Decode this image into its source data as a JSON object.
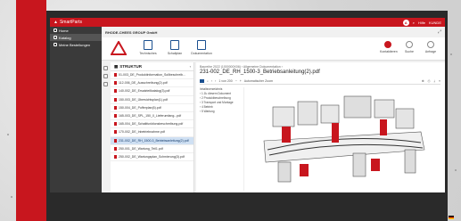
{
  "app": {
    "brand": "SmartParts",
    "company": "RHODE-CHEES GROUP GmbH",
    "user": "Hilfe",
    "account": "KUNDE",
    "avatar_letter": "A",
    "brand_color": "#c8161e",
    "selection_color": "#cfe0f3"
  },
  "sidebar": {
    "items": [
      {
        "label": "Home",
        "icon": "home-icon",
        "active": false
      },
      {
        "label": "Katalog",
        "icon": "book-icon",
        "active": true
      },
      {
        "label": "Meine Bestellungen",
        "icon": "list-icon",
        "active": false
      }
    ]
  },
  "toolbar": {
    "tools": [
      {
        "label": "Technisches",
        "icon": "tech-doc-icon"
      },
      {
        "label": "Schaltplan",
        "icon": "circuit-icon"
      },
      {
        "label": "Dokumentation",
        "icon": "document-icon"
      }
    ],
    "right_tools": [
      {
        "label": "Kontaktieren",
        "icon": "contact-icon"
      },
      {
        "label": "Suche",
        "icon": "search-icon"
      },
      {
        "label": "Anfrage",
        "icon": "cart-icon"
      }
    ]
  },
  "structure": {
    "title": "STRUKTUR",
    "files": [
      "01-003_DE_Produktinformation_Sollbeschreib...",
      "112-006_DE_Ausschreibung(2).pdf",
      "140-002_DE_Ersatzteilkatalog(3).pdf",
      "150-003_DE_Übersichtsplan(1).pdf",
      "150-004_DE_Pufferplan(6).pdf",
      "165-003_DE_SPL_150_0_Lieferumfang...pdf",
      "165-004_DE_Schaltfunktionsbeschreibung.pdf",
      "170-002_DE_Inbetriebnahme.pdf",
      "231-002_DE_RH_1500-3_Betriebsanleitung(2).pdf",
      "250-001_DE_Wartung_Teil1.pdf",
      "250-002_DE_Wartungsplan_Schmierung(3).pdf"
    ],
    "active_index": 8
  },
  "viewer": {
    "breadcrumb": "Baureihe 2022 (1000000X06) › Allgemeine Dokumentation ›",
    "title": "231-002_DE_RH_1500-3_Betriebsanleitung(2).pdf",
    "page_info": "1 von 200",
    "zoom": "Automatischer Zoom",
    "outline": [
      "Inhaltsverzeichnis",
      "› 1 Zu diesem Dokument",
      "› 2 Produktbeschreibung",
      "› 3 Transport und Montage",
      "› 4 Betrieb",
      "› 5 Wartung"
    ]
  }
}
